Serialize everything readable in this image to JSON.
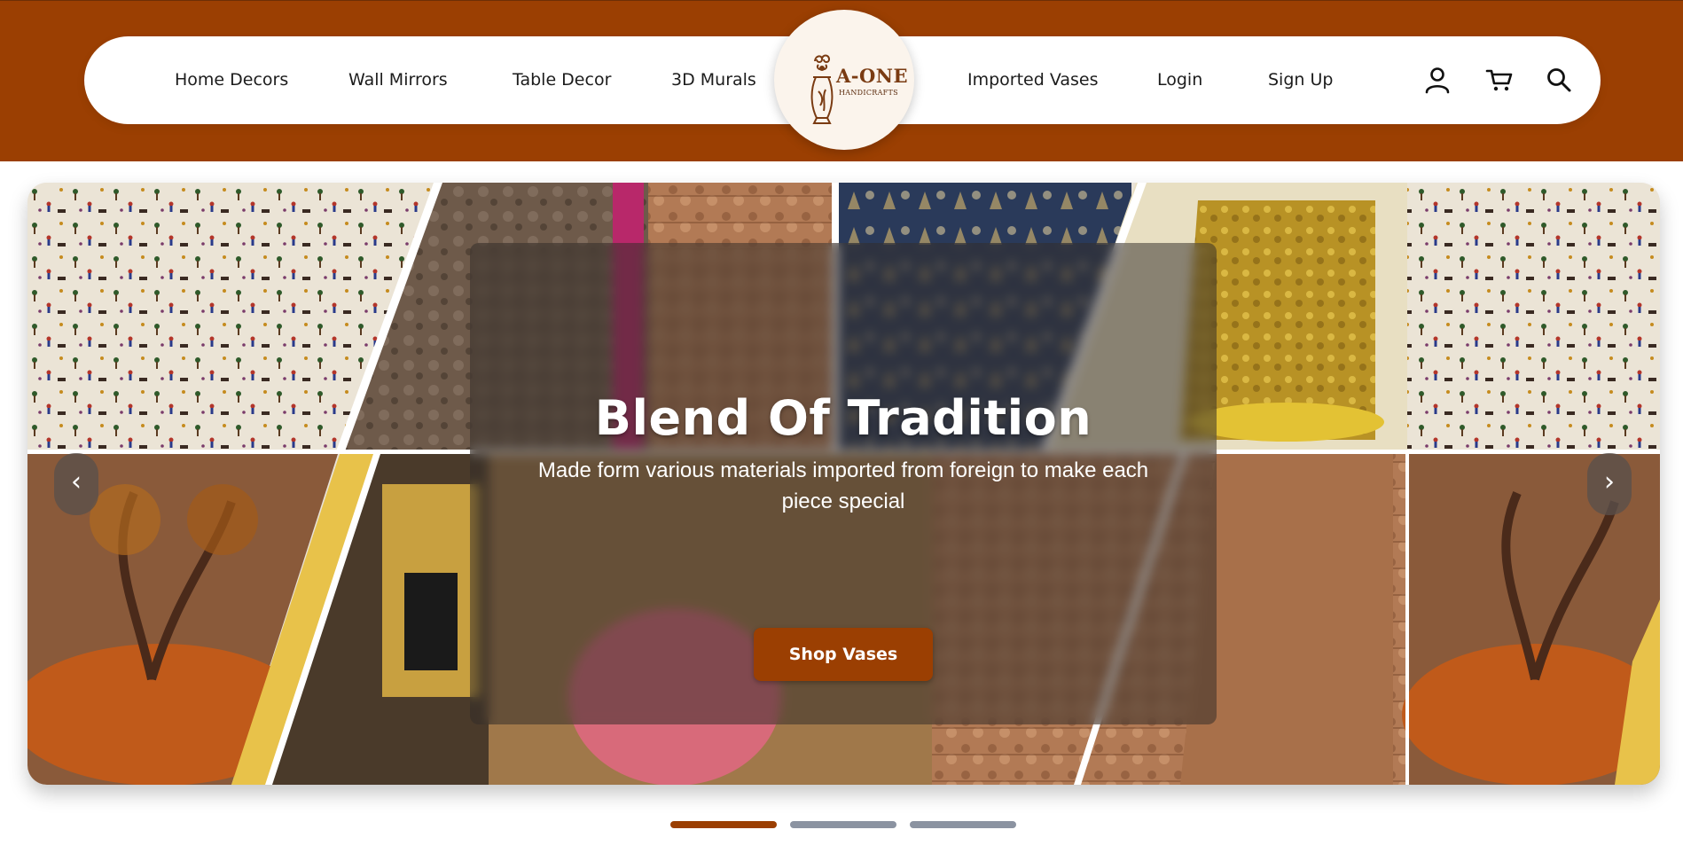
{
  "nav": {
    "links_left": [
      "Home Decors",
      "Wall Mirrors",
      "Table Decor",
      "3D Murals"
    ],
    "links_right": [
      "Imported Vases",
      "Login",
      "Sign Up"
    ],
    "icons": [
      "user-icon",
      "cart-icon",
      "search-icon"
    ]
  },
  "logo": {
    "line1": "A-ONE",
    "line2": "HANDICRAFTS"
  },
  "hero": {
    "title": "Blend Of Tradition",
    "subtitle": "Made form various materials imported from foreign to make each piece special",
    "cta_label": "Shop Vases",
    "prev_label": "‹",
    "next_label": "›"
  },
  "carousel": {
    "slide_count": 3,
    "active_index": 0
  },
  "colors": {
    "brand": "#9b3f02",
    "header_bg": "#9b3f02",
    "dot_inactive": "#8b93a1"
  }
}
